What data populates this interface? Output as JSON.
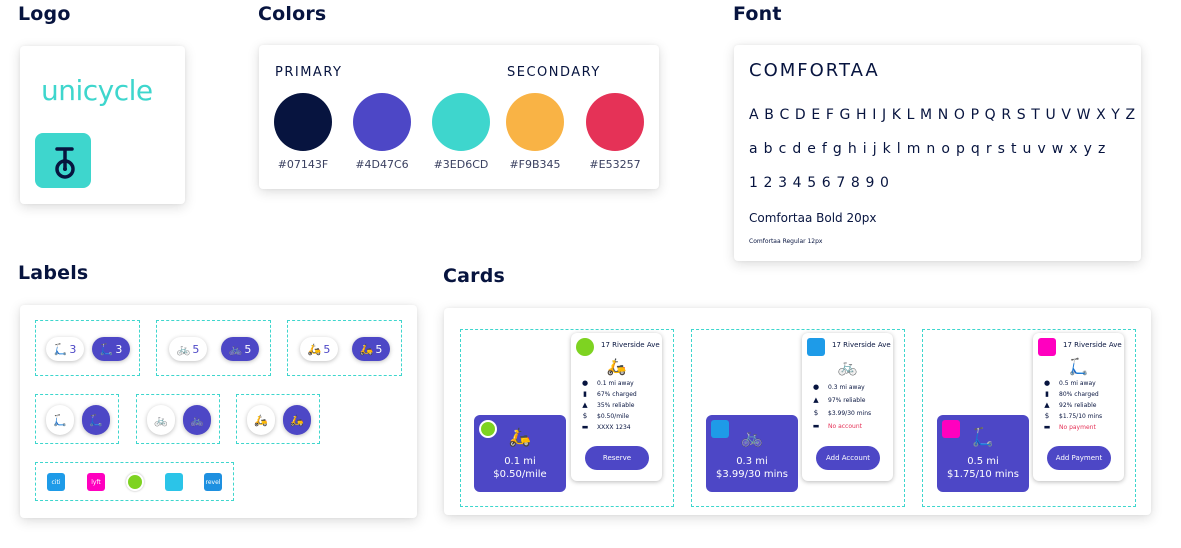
{
  "sections": {
    "logo": "Logo",
    "colors": "Colors",
    "font": "Font",
    "labels": "Labels",
    "cards": "Cards"
  },
  "logo": {
    "wordmark": "unicycle",
    "mark_icon": "unicycle-icon"
  },
  "colors": {
    "primary_label": "PRIMARY",
    "secondary_label": "SECONDARY",
    "swatches": [
      {
        "hex": "#07143F"
      },
      {
        "hex": "#4D47C6"
      },
      {
        "hex": "#3ED6CD"
      },
      {
        "hex": "#F9B345"
      },
      {
        "hex": "#E53257"
      }
    ]
  },
  "font": {
    "name": "COMFORTAA",
    "uppercase": "A B C D E F G H I J K L M N O P Q R S T U V W X Y Z",
    "lowercase": "a b c d e f g h i j k l m n o p q r s t u v w x y z",
    "digits": "1 2 3 4 5 6 7 8 9 0",
    "bold_sample": "Comfortaa Bold 20px",
    "regular_sample": "Comfortaa Regular 12px"
  },
  "labels": {
    "groups": [
      {
        "icon": "scooter-icon",
        "count": "3"
      },
      {
        "icon": "bike-icon",
        "count": "5"
      },
      {
        "icon": "moped-icon",
        "count": "5"
      }
    ],
    "brands": [
      {
        "name": "citi-bike",
        "color": "#1E9BE8",
        "text": "citi"
      },
      {
        "name": "lyft",
        "color": "#FF00BF",
        "text": "lyft"
      },
      {
        "name": "lime",
        "color": "#7ED321",
        "text": ""
      },
      {
        "name": "jump",
        "color": "#2BC4E8",
        "text": ""
      },
      {
        "name": "revel",
        "color": "#1E90E0",
        "text": "revel"
      }
    ]
  },
  "cards": [
    {
      "mini_distance": "0.1 mi",
      "mini_price": "$0.50/mile",
      "address": "17 Riverside Ave",
      "rows": [
        "0.1 mi away",
        "67% charged",
        "35% reliable",
        "$0.50/mile",
        "XXXX 1234"
      ],
      "button": "Reserve",
      "brand_color": "#7ED321",
      "vehicle_icon": "moped-icon"
    },
    {
      "mini_distance": "0.3 mi",
      "mini_price": "$3.99/30 mins",
      "address": "17 Riverside Ave",
      "rows": [
        "0.3 mi away",
        "97% reliable",
        "$3.99/30 mins",
        "No account"
      ],
      "button": "Add Account",
      "brand_color": "#1E9BE8",
      "vehicle_icon": "bike-icon"
    },
    {
      "mini_distance": "0.5 mi",
      "mini_price": "$1.75/10 mins",
      "address": "17 Riverside Ave",
      "rows": [
        "0.5 mi away",
        "80% charged",
        "92% reliable",
        "$1.75/10 mins",
        "No payment"
      ],
      "button": "Add Payment",
      "brand_color": "#FF00BF",
      "vehicle_icon": "scooter-icon"
    }
  ]
}
